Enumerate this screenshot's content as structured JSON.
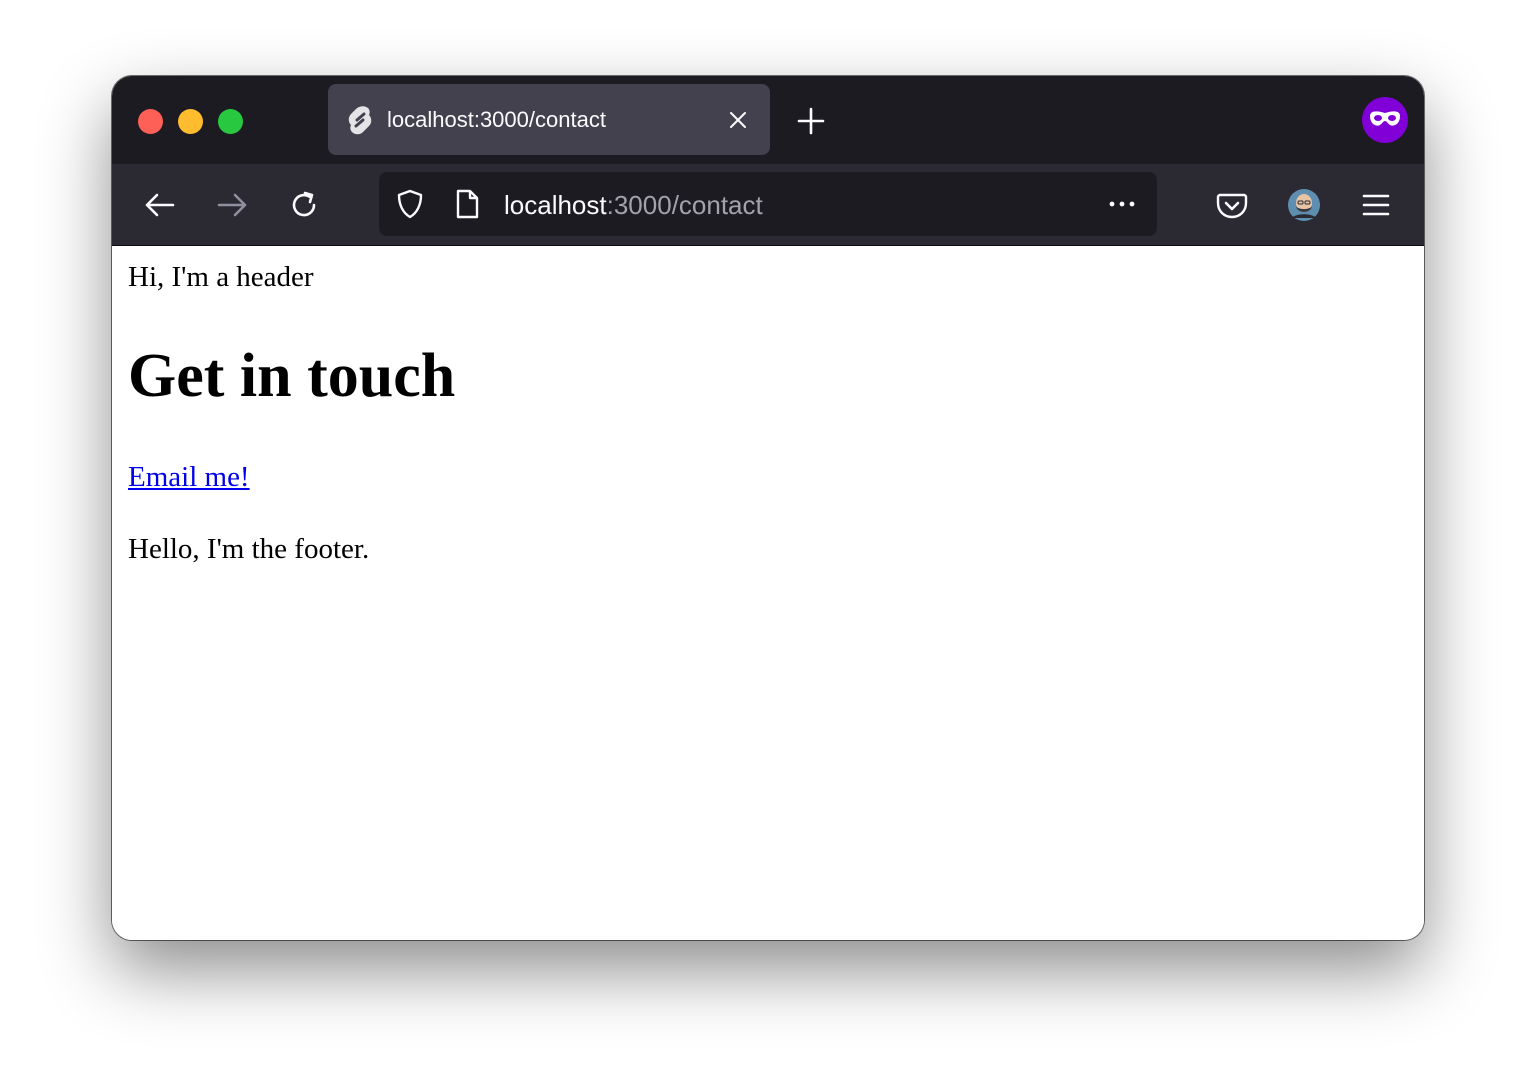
{
  "browser": {
    "tab": {
      "title": "localhost:3000/contact",
      "favicon": "svelte-icon"
    },
    "toolbar": {
      "back_icon": "back-arrow-icon",
      "forward_icon": "forward-arrow-icon",
      "reload_icon": "reload-icon",
      "pocket_icon": "pocket-icon",
      "account_icon": "account-avatar",
      "menu_icon": "hamburger-menu-icon"
    },
    "url": {
      "host": "localhost",
      "rest": ":3000/contact"
    },
    "colors": {
      "tabstrip": "#1c1b22",
      "navbar": "#2b2a33",
      "active_tab": "#42414d",
      "private_badge": "#8000d7"
    }
  },
  "page": {
    "header": "Hi, I'm a header",
    "title": "Get in touch",
    "email_link": "Email me!",
    "footer": "Hello, I'm the footer.",
    "link_color": "#0000ee"
  }
}
